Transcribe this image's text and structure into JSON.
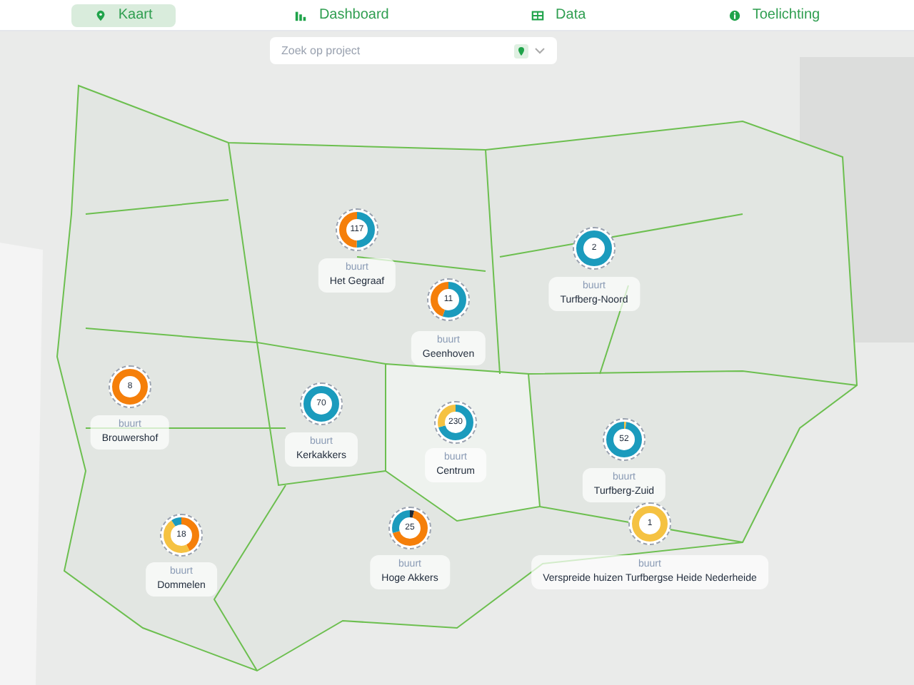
{
  "nav": {
    "tabs": [
      {
        "label": "Kaart",
        "selected": true
      },
      {
        "label": "Dashboard",
        "selected": false
      },
      {
        "label": "Data",
        "selected": false
      },
      {
        "label": "Toelichting",
        "selected": false
      }
    ]
  },
  "search": {
    "placeholder": "Zoek op project"
  },
  "markers": [
    {
      "count": "117",
      "type": "buurt",
      "name": "Het Gegraaf",
      "segments": [
        {
          "color": "#1b9bbd",
          "level": 0.5
        },
        {
          "color": "#f57f0a",
          "level": 0.5
        }
      ]
    },
    {
      "count": "11",
      "type": "buurt",
      "name": "Geenhoven",
      "segments": [
        {
          "color": "#1b9bbd",
          "level": 0.55
        },
        {
          "color": "#f57f0a",
          "level": 0.45
        }
      ]
    },
    {
      "count": "8",
      "type": "buurt",
      "name": "Brouwershof",
      "segments": [
        {
          "color": "#f57f0a",
          "level": 1
        }
      ]
    },
    {
      "count": "70",
      "type": "buurt",
      "name": "Kerkakkers",
      "segments": [
        {
          "color": "#1b9bbd",
          "level": 1
        }
      ]
    },
    {
      "count": "230",
      "type": "buurt",
      "name": "Centrum",
      "segments": [
        {
          "color": "#1b9bbd",
          "level": 0.7
        },
        {
          "color": "#f5c242",
          "level": 0.3
        }
      ]
    },
    {
      "count": "2",
      "type": "buurt",
      "name": "Turfberg-Noord",
      "segments": [
        {
          "color": "#1b9bbd",
          "level": 1
        }
      ]
    },
    {
      "count": "52",
      "type": "buurt",
      "name": "Turfberg-Zuid",
      "segments": [
        {
          "color": "#f5c242",
          "level": 0.02
        },
        {
          "color": "#1b9bbd",
          "level": 0.98
        }
      ]
    },
    {
      "count": "1",
      "type": "buurt",
      "name": "Verspreide huizen Turfbergse Heide Nederheide",
      "segments": [
        {
          "color": "#f5c242",
          "level": 1
        }
      ]
    },
    {
      "count": "18",
      "type": "buurt",
      "name": "Dommelen",
      "segments": [
        {
          "color": "#f57f0a",
          "level": 0.42
        },
        {
          "color": "#f5c242",
          "level": 0.48
        },
        {
          "color": "#1b9bbd",
          "level": 0.1
        }
      ]
    },
    {
      "count": "25",
      "type": "buurt",
      "name": "Hoge Akkers",
      "segments": [
        {
          "color": "#1e2a36",
          "level": 0.04
        },
        {
          "color": "#f57f0a",
          "level": 0.66
        },
        {
          "color": "#1b9bbd",
          "level": 0.3
        }
      ]
    }
  ]
}
